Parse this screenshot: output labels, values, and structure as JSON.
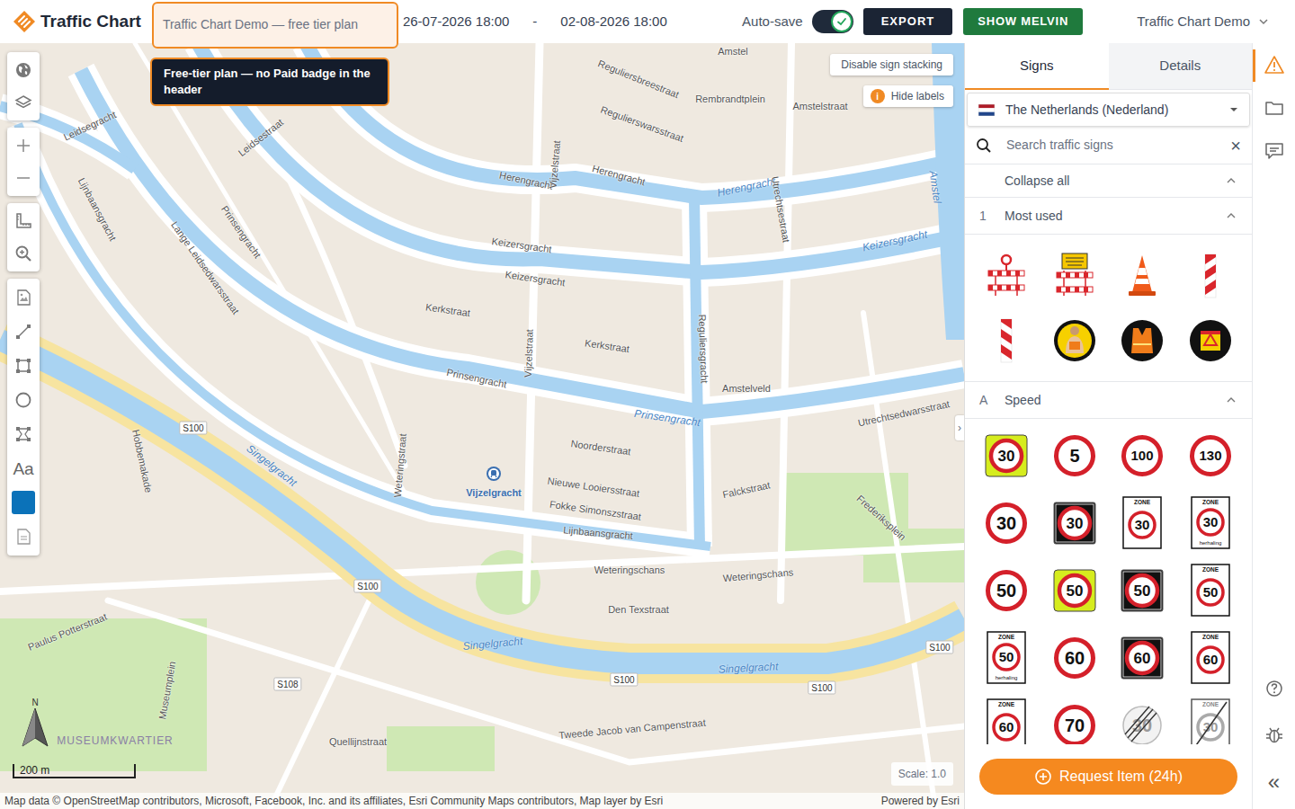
{
  "header": {
    "logo": "Traffic Chart",
    "project_title": "Traffic Chart Demo — free tier plan",
    "start_date": "26-07-2026 18:00",
    "date_separator": "-",
    "end_date": "02-08-2026 18:00",
    "autosave": {
      "label": "Auto-save",
      "on": true
    },
    "buttons": [
      "EXPORT",
      "SHOW MELVIN"
    ],
    "account": "Traffic Chart Demo"
  },
  "tooltip": "Free-tier plan — no Paid badge in the header",
  "toolbar": {
    "groups": [
      [
        {
          "kind": "globe"
        },
        {
          "kind": "layers"
        }
      ],
      [
        {
          "kind": "zoom-in"
        },
        {
          "kind": "zoom-out"
        }
      ],
      [
        {
          "kind": "measure"
        },
        {
          "kind": "search"
        }
      ],
      [
        {
          "kind": "image"
        },
        {
          "kind": "line"
        },
        {
          "kind": "rectangle"
        },
        {
          "kind": "circle"
        },
        {
          "kind": "polygon"
        },
        {
          "kind": "text",
          "label": "Aa"
        },
        {
          "kind": "color",
          "color": "#0b72b9"
        },
        {
          "kind": "document"
        }
      ]
    ]
  },
  "map": {
    "stacking_button": "Disable sign stacking",
    "labels_button": {
      "icon": "i",
      "label": "Hide labels"
    },
    "collapse_handle": "›",
    "labels": [
      {
        "text": "Amstel",
        "kind": "street"
      },
      {
        "text": "Reguliersbreestraat",
        "kind": "street"
      },
      {
        "text": "Rembrandtplein",
        "kind": "street"
      },
      {
        "text": "Amstelstraat",
        "kind": "street"
      },
      {
        "text": "Regulierswarsstraat",
        "kind": "street"
      },
      {
        "text": "Herengracht",
        "kind": "street"
      },
      {
        "text": "Herengracht",
        "kind": "street"
      },
      {
        "text": "Herengracht",
        "kind": "water"
      },
      {
        "text": "Keizersgracht",
        "kind": "street"
      },
      {
        "text": "Keizersgracht",
        "kind": "street"
      },
      {
        "text": "Keizersgracht",
        "kind": "water"
      },
      {
        "text": "Kerkstraat",
        "kind": "street"
      },
      {
        "text": "Kerkstraat",
        "kind": "street"
      },
      {
        "text": "Prinsengracht",
        "kind": "street"
      },
      {
        "text": "Prinsengracht",
        "kind": "water"
      },
      {
        "text": "Prinsengracht",
        "kind": "street"
      },
      {
        "text": "Vijzelstraat",
        "kind": "street"
      },
      {
        "text": "Vijzelstraat",
        "kind": "street"
      },
      {
        "text": "Utrechtsestraat",
        "kind": "street"
      },
      {
        "text": "Reguliersgracht",
        "kind": "street"
      },
      {
        "text": "Leidsegracht",
        "kind": "street"
      },
      {
        "text": "Leidsestraat",
        "kind": "street"
      },
      {
        "text": "Lange Leidsedwarsstraat",
        "kind": "street"
      },
      {
        "text": "Lijnbaansgracht",
        "kind": "street"
      },
      {
        "text": "Singelgracht",
        "kind": "water"
      },
      {
        "text": "Singelgracht",
        "kind": "water"
      },
      {
        "text": "Singelgracht",
        "kind": "water"
      },
      {
        "text": "Weteringschans",
        "kind": "street"
      },
      {
        "text": "Weteringschans",
        "kind": "street"
      },
      {
        "text": "Den Texstraat",
        "kind": "street"
      },
      {
        "text": "Noorderstraat",
        "kind": "street"
      },
      {
        "text": "Nieuwe Looiersstraat",
        "kind": "street"
      },
      {
        "text": "Fokke Simonszstraat",
        "kind": "street"
      },
      {
        "text": "Lijnbaansgracht",
        "kind": "street"
      },
      {
        "text": "Tweede Jacob van Campenstraat",
        "kind": "street"
      },
      {
        "text": "Quellijnstraat",
        "kind": "street"
      },
      {
        "text": "Hobbemakade",
        "kind": "street"
      },
      {
        "text": "Frederiksplein",
        "kind": "street"
      },
      {
        "text": "Falckstraat",
        "kind": "street"
      },
      {
        "text": "Museumplein",
        "kind": "street"
      },
      {
        "text": "MUSEUMKWARTIER",
        "kind": "district"
      },
      {
        "text": "Vijzelgracht",
        "kind": "station"
      },
      {
        "text": "Amstelveld",
        "kind": "street"
      },
      {
        "text": "Paulus Potterstraat",
        "kind": "street"
      },
      {
        "text": "Amstel",
        "kind": "water"
      },
      {
        "text": "S100",
        "kind": "shield"
      },
      {
        "text": "S100",
        "kind": "shield"
      },
      {
        "text": "S100",
        "kind": "shield"
      },
      {
        "text": "S100",
        "kind": "shield"
      },
      {
        "text": "S100",
        "kind": "shield"
      },
      {
        "text": "S108",
        "kind": "shield"
      },
      {
        "text": "Weteringstraat",
        "kind": "street"
      },
      {
        "text": "Utrechtsedwarsstraat",
        "kind": "street"
      }
    ],
    "north": "N",
    "scale_bar": "200 m",
    "scale": "Scale: 1.0",
    "attribution": "Map data © OpenStreetMap contributors, Microsoft, Facebook, Inc. and its affiliates, Esri Community Maps contributors, Map layer by Esri",
    "powered_by": "Powered by Esri"
  },
  "panel": {
    "tabs": [
      {
        "label": "Signs",
        "selected": true
      },
      {
        "label": "Details",
        "selected": false
      }
    ],
    "country": "The Netherlands (Nederland)",
    "search": {
      "placeholder": "Search traffic signs",
      "clear": "×"
    },
    "collapse_all": "Collapse all",
    "sections": [
      {
        "key": "1",
        "title": "Most used",
        "expanded": true,
        "signs": [
          {
            "kind": "barrier-light"
          },
          {
            "kind": "barrier-sign"
          },
          {
            "kind": "cone"
          },
          {
            "kind": "beacon-right"
          },
          {
            "kind": "beacon-left"
          },
          {
            "kind": "worker"
          },
          {
            "kind": "vest"
          },
          {
            "kind": "light-sign"
          }
        ]
      },
      {
        "key": "A",
        "title": "Speed",
        "expanded": true,
        "signs": [
          {
            "kind": "yellow",
            "value": "30"
          },
          {
            "kind": "round",
            "value": "5"
          },
          {
            "kind": "round",
            "value": "100"
          },
          {
            "kind": "round",
            "value": "130"
          },
          {
            "kind": "round",
            "value": "30"
          },
          {
            "kind": "black",
            "value": "30"
          },
          {
            "kind": "zone",
            "value": "30",
            "zone": "ZONE"
          },
          {
            "kind": "zone",
            "value": "30",
            "zone": "ZONE",
            "note": "herhaling"
          },
          {
            "kind": "round",
            "value": "50"
          },
          {
            "kind": "yellow",
            "value": "50"
          },
          {
            "kind": "black",
            "value": "50"
          },
          {
            "kind": "zone",
            "value": "50",
            "zone": "ZONE"
          },
          {
            "kind": "zone",
            "value": "50",
            "zone": "ZONE",
            "note": "herhaling"
          },
          {
            "kind": "round",
            "value": "60"
          },
          {
            "kind": "black",
            "value": "60"
          },
          {
            "kind": "zone",
            "value": "60",
            "zone": "ZONE"
          },
          {
            "kind": "zone",
            "value": "60",
            "zone": "ZONE"
          },
          {
            "kind": "round",
            "value": "70"
          },
          {
            "kind": "end",
            "value": "30"
          },
          {
            "kind": "end-zone",
            "value": "30",
            "zone": "ZONE"
          }
        ]
      }
    ],
    "request_button": "Request Item (24h)"
  },
  "rail": {
    "top": [
      {
        "kind": "warning",
        "selected": true
      },
      {
        "kind": "folder",
        "selected": false
      },
      {
        "kind": "chat",
        "selected": false
      }
    ],
    "bottom": [
      {
        "kind": "help"
      },
      {
        "kind": "bug"
      },
      {
        "kind": "collapse",
        "label": "«"
      }
    ]
  }
}
